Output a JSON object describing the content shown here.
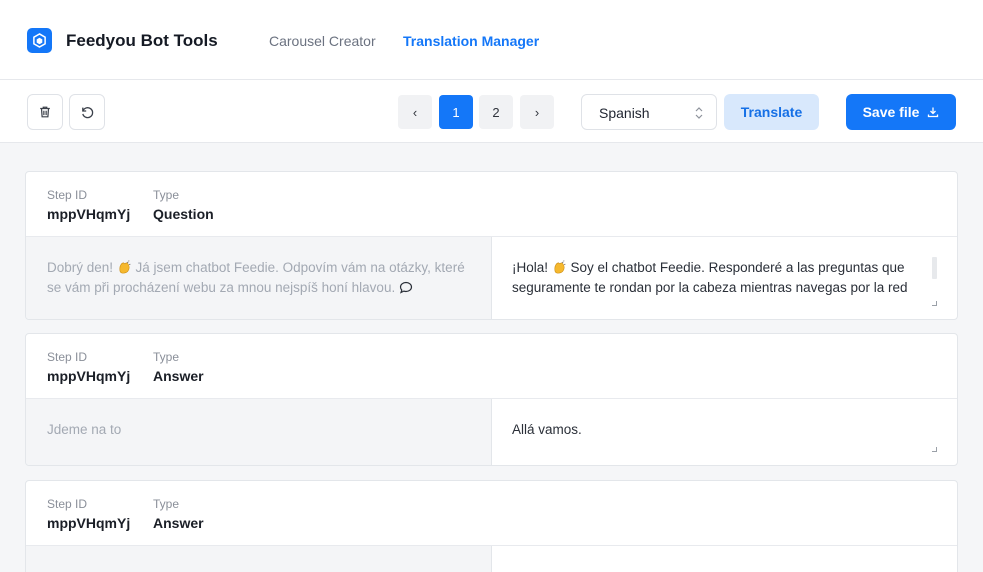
{
  "app": {
    "brand": "Feedyou Bot Tools",
    "nav": [
      {
        "label": "Carousel Creator",
        "active": false
      },
      {
        "label": "Translation Manager",
        "active": true
      }
    ]
  },
  "toolbar": {
    "pages": [
      "1",
      "2"
    ],
    "current_page": "1",
    "prev_label": "‹",
    "next_label": "›",
    "language": "Spanish",
    "translate_label": "Translate",
    "save_label": "Save file"
  },
  "labels": {
    "step_id": "Step ID",
    "type": "Type"
  },
  "steps": [
    {
      "id": "mppVHqmYj",
      "type": "Question",
      "source_a": "Dobrý den! ",
      "source_b": " Já jsem chatbot Feedie. Odpovím vám na otázky, které se vám při procházení webu za mnou nejspíš honí hlavou. ",
      "target_a": "¡Hola! ",
      "target_b": " Soy el chatbot Feedie. Responderé a las preguntas que seguramente te rondan por la cabeza mientras navegas por la red"
    },
    {
      "id": "mppVHqmYj",
      "type": "Answer",
      "source": "Jdeme na to",
      "target": "Allá vamos."
    },
    {
      "id": "mppVHqmYj",
      "type": "Answer"
    }
  ],
  "colors": {
    "accent": "#1477f8",
    "accent_soft": "#d8e8fc",
    "source_bg": "#f4f5f7"
  },
  "icons": [
    "logo-icon",
    "trash-icon",
    "undo-icon",
    "chevron-left-icon",
    "chevron-right-icon",
    "select-arrows-icon",
    "download-icon",
    "clap-emoji-icon",
    "speech-bubble-icon"
  ]
}
